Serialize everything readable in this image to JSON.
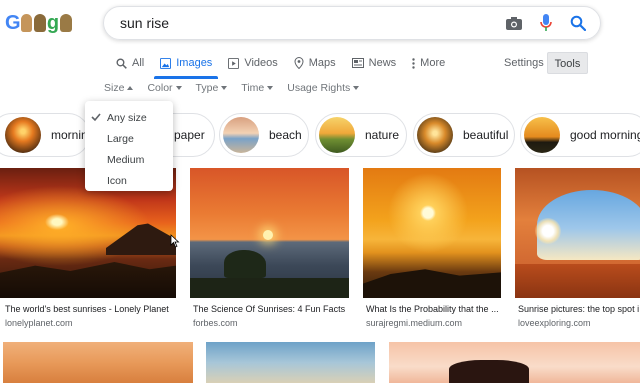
{
  "search": {
    "query": "sun rise"
  },
  "tabs": [
    {
      "label": "All",
      "icon": "search-icon"
    },
    {
      "label": "Images",
      "icon": "image-icon"
    },
    {
      "label": "Videos",
      "icon": "video-icon"
    },
    {
      "label": "Maps",
      "icon": "map-pin-icon"
    },
    {
      "label": "News",
      "icon": "news-icon"
    },
    {
      "label": "More",
      "icon": "more-vert-icon"
    }
  ],
  "header": {
    "settings_label": "Settings",
    "tools_label": "Tools"
  },
  "filters": [
    {
      "label": "Size"
    },
    {
      "label": "Color"
    },
    {
      "label": "Type"
    },
    {
      "label": "Time"
    },
    {
      "label": "Usage Rights"
    }
  ],
  "size_menu": {
    "items": [
      "Any size",
      "Large",
      "Medium",
      "Icon"
    ],
    "selected": "Any size"
  },
  "chips": [
    "morning",
    "paper",
    "beach",
    "nature",
    "beautiful",
    "good morning"
  ],
  "results": [
    {
      "title": "The world's best sunrises - Lonely Planet",
      "source": "lonelyplanet.com"
    },
    {
      "title": "The Science Of Sunrises: 4 Fun Facts",
      "source": "forbes.com"
    },
    {
      "title": "What Is the Probability that the ...",
      "source": "surajregmi.medium.com"
    },
    {
      "title": "Sunrise pictures: the top spot i",
      "source": "loveexploring.com"
    }
  ],
  "colors": {
    "accent": "#1a73e8",
    "text": "#202124",
    "muted": "#5f6368"
  }
}
